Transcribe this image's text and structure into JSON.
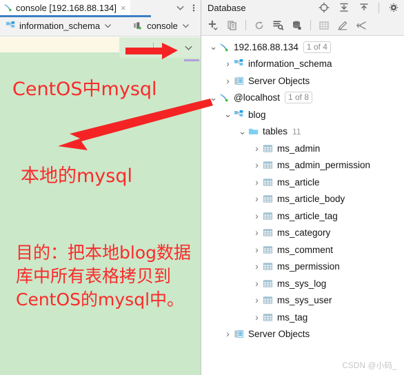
{
  "editor": {
    "tab": {
      "label": "console [192.168.88.134]",
      "close_label": "×",
      "icon": "dolphin-mysql-icon"
    },
    "tabbar_actions": {
      "dropdown_label": "⌄",
      "more_label": "⋮"
    },
    "toolbar": {
      "schema_selector": "information_schema",
      "session_selector": "console",
      "chevron": "⌄"
    },
    "find_widget": {
      "prev_label": "∧",
      "next_label": "∨"
    },
    "annotations": {
      "centos_mysql": "CentOS中mysql",
      "local_mysql": "本地的mysql",
      "purpose_line1": "目的：把本地blog数据",
      "purpose_line2": "库中所有表格拷贝到",
      "purpose_line3": "CentOS的mysql中。",
      "color": "#fa2a2a"
    }
  },
  "database_panel": {
    "title": "Database",
    "header_icons": [
      {
        "name": "locate-target-icon",
        "label": ""
      },
      {
        "name": "expand-all-icon",
        "label": ""
      },
      {
        "name": "collapse-all-icon",
        "label": ""
      },
      {
        "name": "settings-gear-icon",
        "label": ""
      }
    ],
    "toolbar_icons": [
      {
        "name": "add-new-icon",
        "label": ""
      },
      {
        "name": "duplicate-icon",
        "label": ""
      },
      {
        "name": "refresh-icon",
        "label": ""
      },
      {
        "name": "sync-settings-icon",
        "label": ""
      },
      {
        "name": "database-stack-icon",
        "label": ""
      },
      {
        "name": "table-grid-icon",
        "label": ""
      },
      {
        "name": "modify-edit-icon",
        "label": ""
      },
      {
        "name": "jump-to-icon",
        "label": ""
      }
    ],
    "tree": [
      {
        "id": "remote-server",
        "label": "192.168.88.134",
        "badge": "1 of 4",
        "icon": "dolphin-mysql-icon",
        "twisty": "⌄",
        "indent": 0,
        "highlighted": true
      },
      {
        "id": "information-schema",
        "label": "information_schema",
        "icon": "schema-icon",
        "twisty": "›",
        "indent": 1
      },
      {
        "id": "server-objects-remote",
        "label": "Server Objects",
        "icon": "server-objects-icon",
        "twisty": "›",
        "indent": 1
      },
      {
        "id": "localhost",
        "label": "@localhost",
        "badge": "1 of 8",
        "icon": "dolphin-mysql-icon",
        "twisty": "⌄",
        "indent": 0
      },
      {
        "id": "blog",
        "label": "blog",
        "icon": "schema-icon",
        "twisty": "⌄",
        "indent": 1
      },
      {
        "id": "tables-folder",
        "label": "tables",
        "count": "11",
        "icon": "folder-icon",
        "twisty": "⌄",
        "indent": 2
      },
      {
        "id": "t1",
        "label": "ms_admin",
        "icon": "table-icon",
        "twisty": "›",
        "indent": 3
      },
      {
        "id": "t2",
        "label": "ms_admin_permission",
        "icon": "table-icon",
        "twisty": "›",
        "indent": 3
      },
      {
        "id": "t3",
        "label": "ms_article",
        "icon": "table-icon",
        "twisty": "›",
        "indent": 3
      },
      {
        "id": "t4",
        "label": "ms_article_body",
        "icon": "table-icon",
        "twisty": "›",
        "indent": 3
      },
      {
        "id": "t5",
        "label": "ms_article_tag",
        "icon": "table-icon",
        "twisty": "›",
        "indent": 3
      },
      {
        "id": "t6",
        "label": "ms_category",
        "icon": "table-icon",
        "twisty": "›",
        "indent": 3
      },
      {
        "id": "t7",
        "label": "ms_comment",
        "icon": "table-icon",
        "twisty": "›",
        "indent": 3
      },
      {
        "id": "t8",
        "label": "ms_permission",
        "icon": "table-icon",
        "twisty": "›",
        "indent": 3
      },
      {
        "id": "t9",
        "label": "ms_sys_log",
        "icon": "table-icon",
        "twisty": "›",
        "indent": 3
      },
      {
        "id": "t10",
        "label": "ms_sys_user",
        "icon": "table-icon",
        "twisty": "›",
        "indent": 3
      },
      {
        "id": "t11",
        "label": "ms_tag",
        "icon": "table-icon",
        "twisty": "›",
        "indent": 3
      },
      {
        "id": "server-objects-local",
        "label": "Server Objects",
        "icon": "server-objects-icon",
        "twisty": "›",
        "indent": 1
      }
    ]
  },
  "watermark": "CSDN @小码_"
}
